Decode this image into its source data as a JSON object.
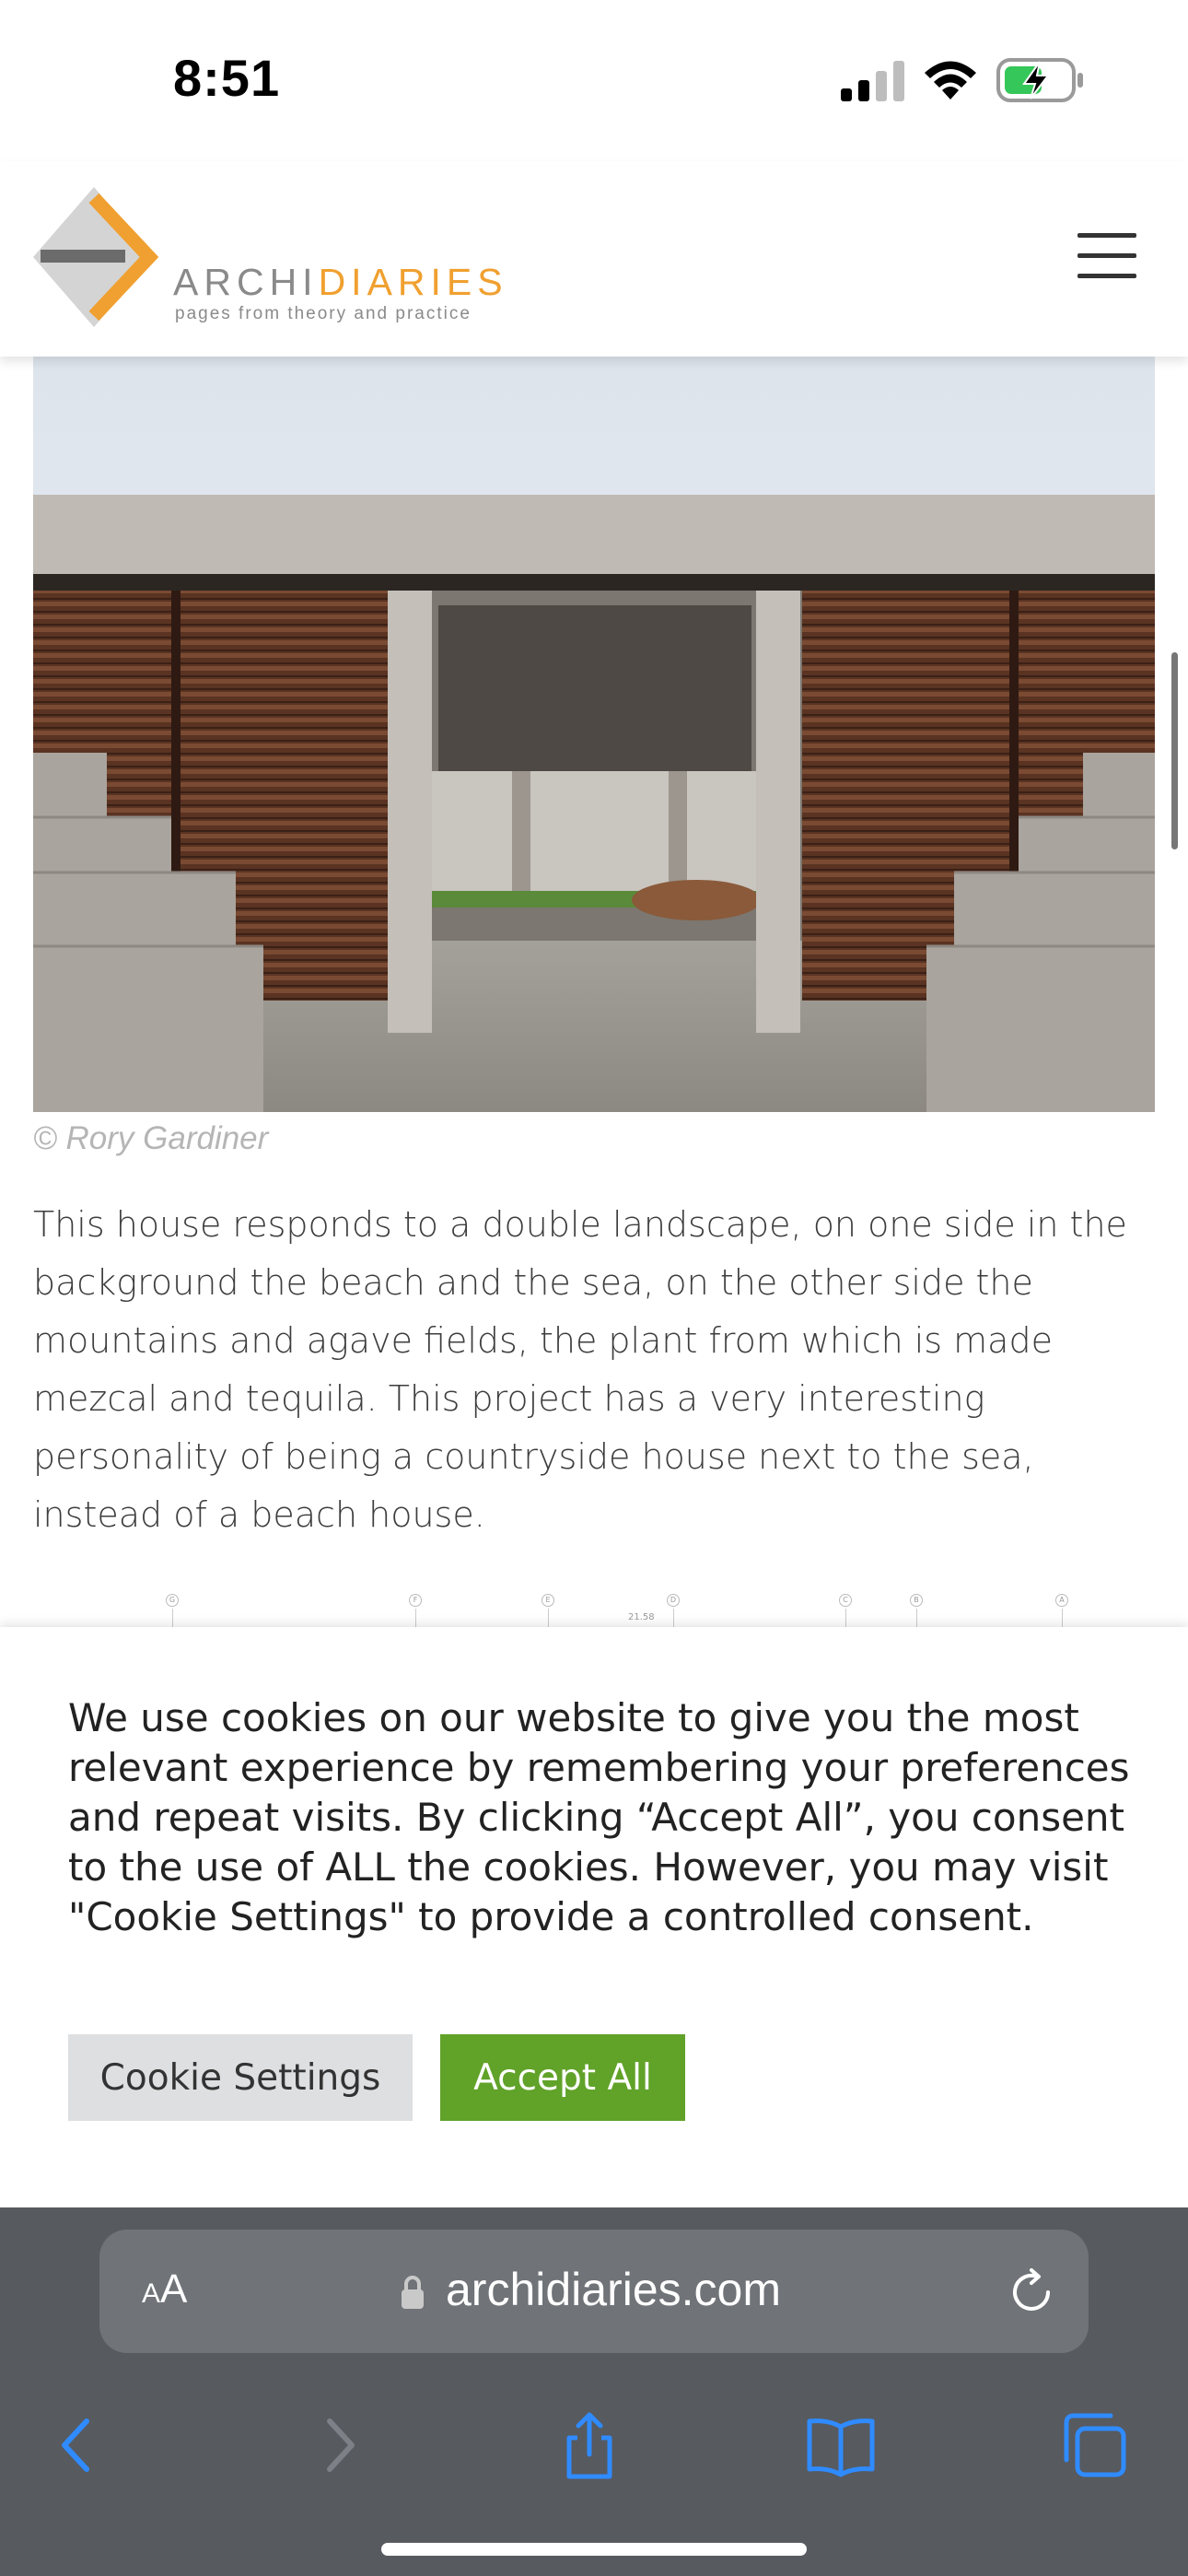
{
  "status_bar": {
    "time": "8:51"
  },
  "header": {
    "logo_part1": "ARCHI",
    "logo_part2": "DIARIES",
    "tagline": "pages from theory and practice",
    "brand_color": "#f0a030"
  },
  "article": {
    "image_caption": "© Rory Gardiner",
    "paragraph": "This house responds to a double landscape, on one side in the background the beach and the sea, on the other side the mountains and agave fields, the plant from which is made mezcal and tequila. This project has a very interesting personality of being a countryside house next to the sea, instead of a beach house.",
    "drawing_labels": [
      "G",
      "F",
      "E",
      "D",
      "C",
      "B",
      "A"
    ],
    "drawing_dimension": "21.58"
  },
  "cookie_banner": {
    "text": "We use cookies on our website to give you the most relevant experience by remembering your preferences and repeat visits. By clicking “Accept All”, you consent to the use of ALL the cookies. However, you may visit \"Cookie Settings\" to provide a controlled consent.",
    "settings_label": "Cookie Settings",
    "accept_label": "Accept All",
    "accept_color": "#61a229"
  },
  "browser": {
    "aa_small": "A",
    "aa_big": "A",
    "url": "archidiaries.com",
    "icons": [
      "back-icon",
      "forward-icon",
      "share-icon",
      "bookmarks-icon",
      "tabs-icon"
    ]
  }
}
